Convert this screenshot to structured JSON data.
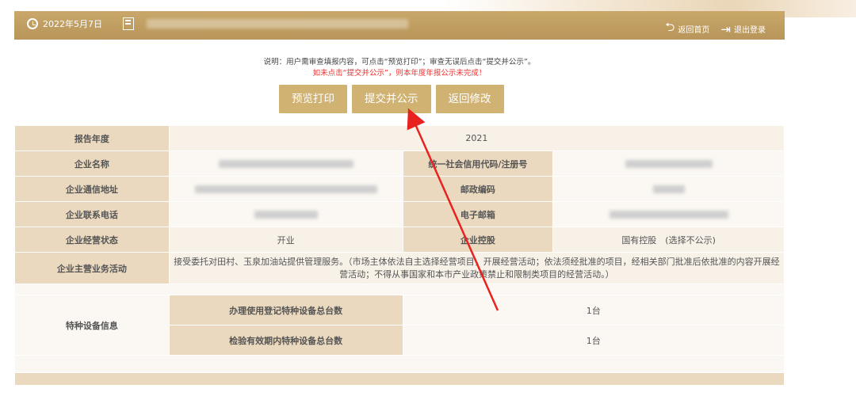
{
  "header": {
    "date": "2022年5月7日",
    "home_label": "返回首页",
    "logout_label": "退出登录"
  },
  "instructions": {
    "note": "说明：用户需审查填报内容，可点击“预览打印”；审查无误后点击“提交并公示”。",
    "warning": "如未点击“提交并公示”，则本年度年报公示未完成！"
  },
  "buttons": {
    "preview": "预览打印",
    "submit": "提交并公示",
    "back": "返回修改"
  },
  "report": {
    "year_label": "报告年度",
    "year_value": "2021",
    "name_label": "企业名称",
    "credit_code_label": "统一社会信用代码/注册号",
    "address_label": "企业通信地址",
    "postcode_label": "邮政编码",
    "phone_label": "企业联系电话",
    "email_label": "电子邮箱",
    "status_label": "企业经营状态",
    "status_value": "开业",
    "holding_label": "企业控股",
    "holding_value": "国有控股　(选择不公示)",
    "business_label": "企业主营业务活动",
    "business_value": "接受委托对田村、玉泉加油站提供管理服务。（市场主体依法自主选择经营项目，开展经营活动；依法须经批准的项目，经相关部门批准后依批准的内容开展经营活动；不得从事国家和本市产业政策禁止和限制类项目的经营活动。）",
    "equipment_label": "特种设备信息",
    "equipment_registered_label": "办理使用登记特种设备总台数",
    "equipment_registered_value": "1台",
    "equipment_inspected_label": "检验有效期内特种设备总台数",
    "equipment_inspected_value": "1台"
  },
  "annotation_color": "#e8231f"
}
